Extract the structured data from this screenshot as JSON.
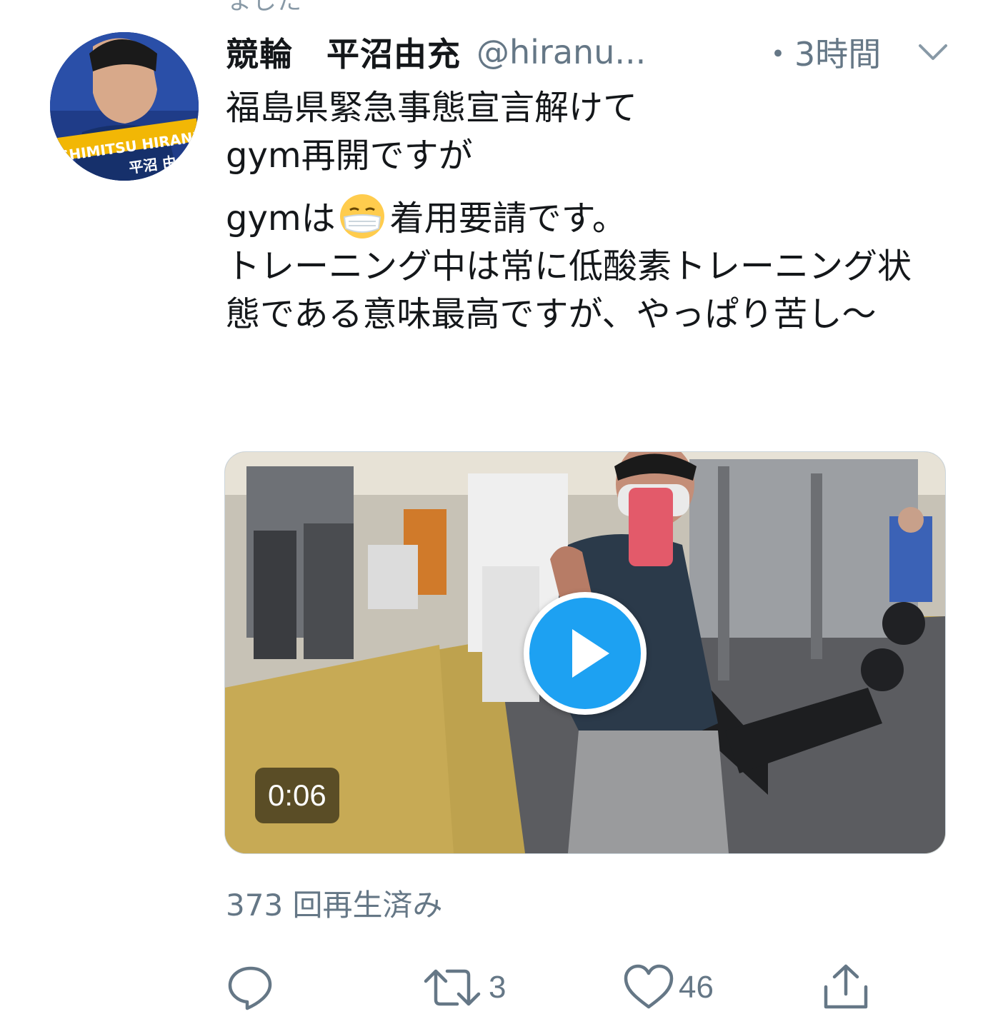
{
  "header_cut_text": "ました",
  "tweet": {
    "display_name": "競輪　平沼由充",
    "handle": "@hiranu...",
    "time": "・3時間",
    "avatar_text": {
      "line1": "SHIMITSU HIRANUMA",
      "line2": "平沼 由"
    },
    "text": {
      "line1": "福島県緊急事態宣言解けて",
      "line2": "gym再開ですが",
      "line3_before": "gymは",
      "line3_after": "着用要請です。",
      "line4": "トレーニング中は常に低酸素トレーニング状態である意味最高ですが、やっぱり苦し〜"
    },
    "media": {
      "duration": "0:06"
    },
    "views": "373 回再生済み",
    "actions": {
      "reply_icon": "reply-icon",
      "retweet_icon": "retweet-icon",
      "retweet_count": "3",
      "like_icon": "heart-icon",
      "like_count": "46",
      "share_icon": "share-icon"
    }
  },
  "colors": {
    "accent": "#1da1f2",
    "secondary_text": "#657786",
    "primary_text": "#14171a"
  }
}
